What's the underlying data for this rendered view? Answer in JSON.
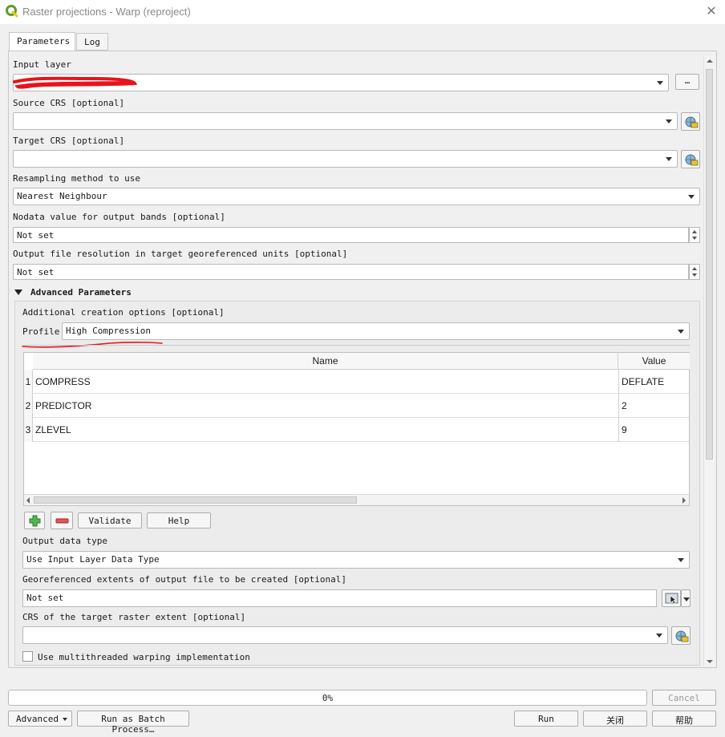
{
  "window": {
    "title": "Raster projections - Warp (reproject)"
  },
  "tabs": [
    {
      "label": "Parameters"
    },
    {
      "label": "Log"
    }
  ],
  "params": {
    "input_layer": {
      "label": "Input layer",
      "value": "",
      "browse_label": "…"
    },
    "source_crs": {
      "label": "Source CRS [optional]",
      "value": ""
    },
    "target_crs": {
      "label": "Target CRS [optional]",
      "value": ""
    },
    "resampling": {
      "label": "Resampling method to use",
      "value": "Nearest Neighbour"
    },
    "nodata": {
      "label": "Nodata value for output bands [optional]",
      "value": "Not set"
    },
    "resolution": {
      "label": "Output file resolution in target georeferenced units [optional]",
      "value": "Not set"
    }
  },
  "advanced": {
    "header": "Advanced Parameters",
    "creation_options_label": "Additional creation options [optional]",
    "profile_label": "Profile",
    "profile_value": "High Compression",
    "table": {
      "columns": [
        "Name",
        "Value"
      ],
      "rows": [
        {
          "index": "1",
          "name": "COMPRESS",
          "value": "DEFLATE"
        },
        {
          "index": "2",
          "name": "PREDICTOR",
          "value": "2"
        },
        {
          "index": "3",
          "name": "ZLEVEL",
          "value": "9"
        }
      ]
    },
    "validate_label": "Validate",
    "help_label": "Help",
    "output_type_label": "Output data type",
    "output_type_value": "Use Input Layer Data Type",
    "extent_label": "Georeferenced extents of output file to be created [optional]",
    "extent_value": "Not set",
    "extent_crs_label": "CRS of the target raster extent [optional]",
    "extent_crs_value": "",
    "multithread_label": "Use multithreaded warping implementation"
  },
  "footer": {
    "progress_text": "0%",
    "progress_value": 0,
    "cancel_label": "Cancel",
    "advanced_label": "Advanced",
    "batch_label": "Run as Batch Process…",
    "run_label": "Run",
    "close_label": "关闭",
    "help_label": "帮助"
  },
  "colors": {
    "annotation_red": "#e8141c",
    "plus_green": "#2e9a2e",
    "minus_red": "#d23a3a"
  }
}
